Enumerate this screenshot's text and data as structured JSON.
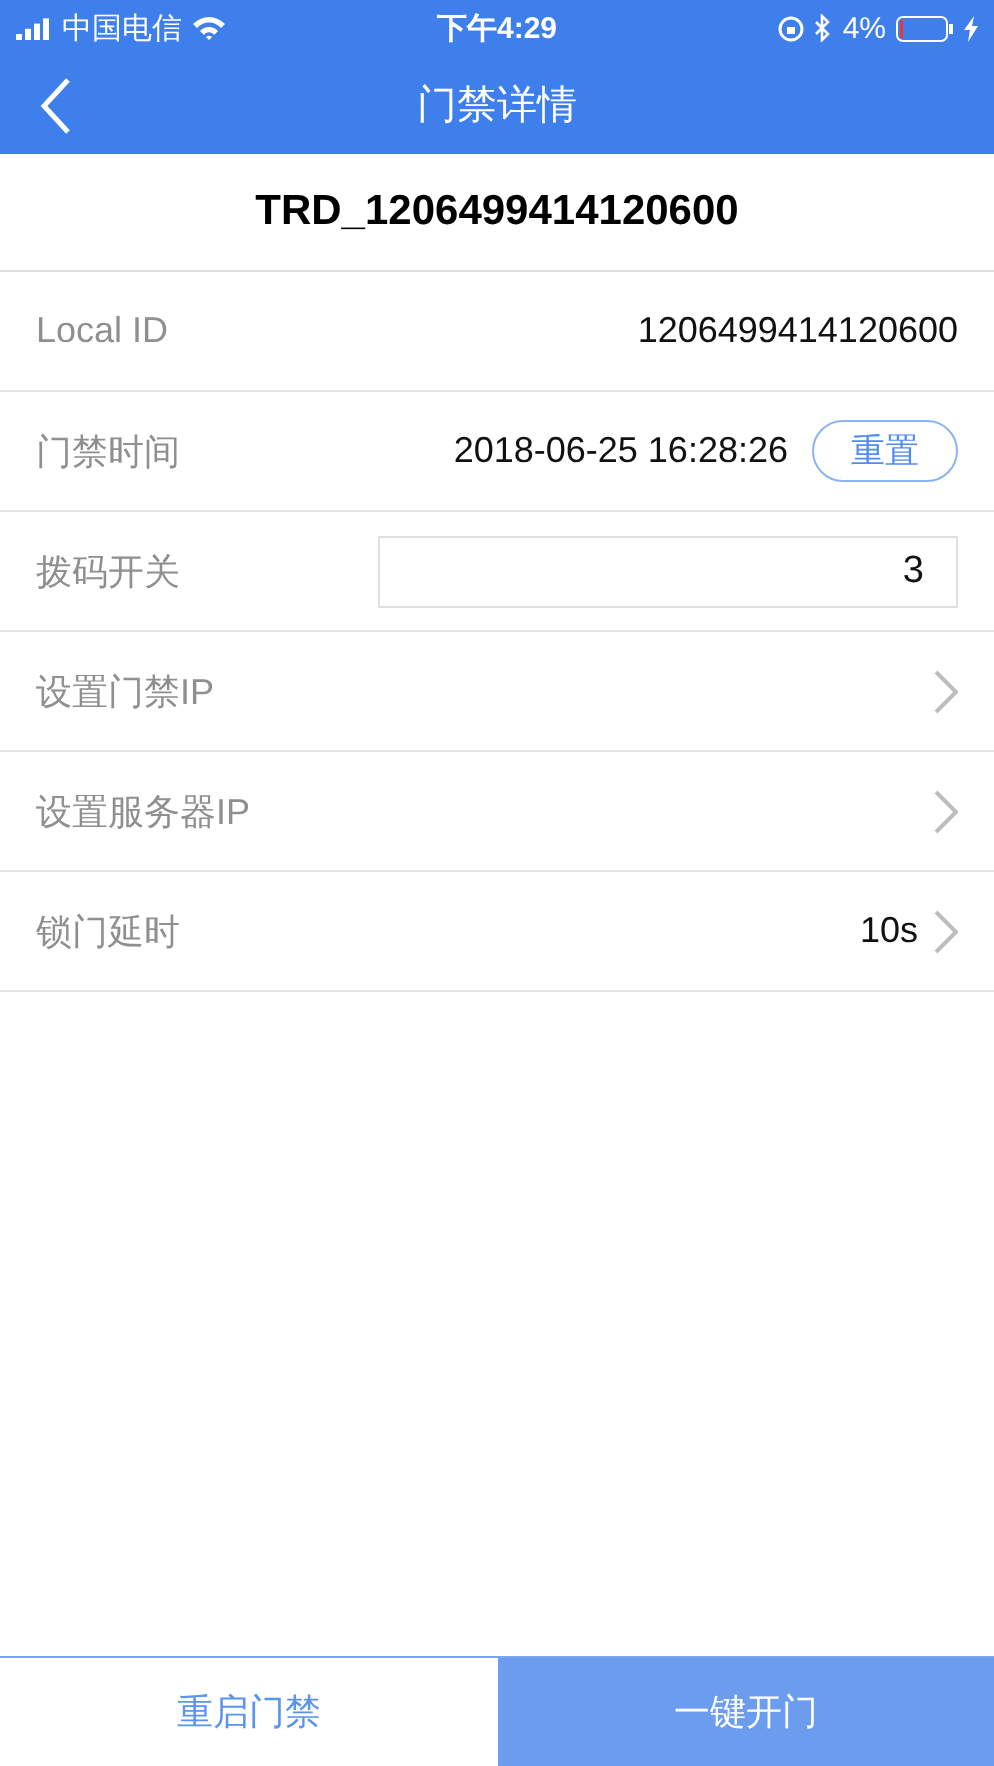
{
  "status_bar": {
    "carrier": "中国电信",
    "time": "下午4:29",
    "battery": "4%"
  },
  "nav": {
    "title": "门禁详情"
  },
  "device_name": "TRD_1206499414120600",
  "rows": [
    {
      "kind": "value",
      "label": "Local ID",
      "value": "1206499414120600"
    },
    {
      "kind": "value_button",
      "label": "门禁时间",
      "value": "2018-06-25 16:28:26",
      "button": "重置"
    },
    {
      "kind": "input",
      "label": "拨码开关",
      "value": "3"
    },
    {
      "kind": "link",
      "label": "设置门禁IP"
    },
    {
      "kind": "link",
      "label": "设置服务器IP"
    },
    {
      "kind": "link",
      "label": "锁门延时",
      "value": "10s"
    }
  ],
  "buttons": [
    {
      "label": "重启门禁",
      "kind": "secondary"
    },
    {
      "label": "一键开门",
      "kind": "primary"
    }
  ]
}
